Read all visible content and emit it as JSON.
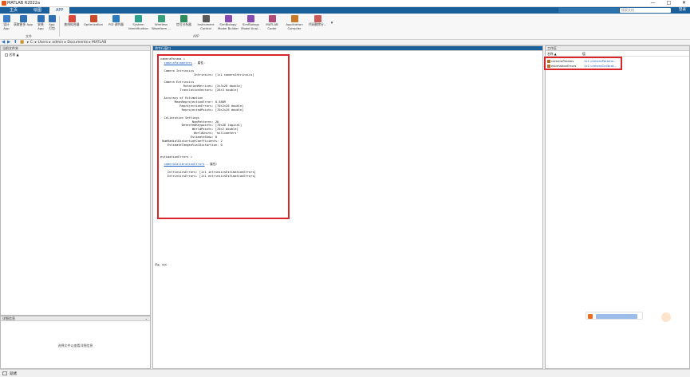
{
  "window": {
    "title": "MATLAB R2022a",
    "controls": [
      "—",
      "□",
      "✕"
    ]
  },
  "tabs": [
    {
      "label": "主页"
    },
    {
      "label": "绘图"
    },
    {
      "label": "APP"
    }
  ],
  "search": {
    "placeholder": "搜索文档"
  },
  "login_label": "登录",
  "toolstrip": {
    "file_group": [
      {
        "label": "设计\nApp"
      },
      {
        "label": "获取更多 App"
      },
      {
        "label": "安装\nApp"
      },
      {
        "label": "App\n打包"
      }
    ],
    "file_group_label": "文件",
    "apps": [
      {
        "label": "曲线拟合器",
        "color": "#d9473d"
      },
      {
        "label": "Optimization",
        "color": "#c94b2a"
      },
      {
        "label": "PID 调节器",
        "color": "#2b7bbd"
      },
      {
        "label": "System\nIdentification",
        "color": "#2f9f8e"
      },
      {
        "label": "Wireless\nWaveform ...",
        "color": "#3a9f7a"
      },
      {
        "label": "信号分析器",
        "color": "#2d8a5a"
      },
      {
        "label": "Instrument\nControl",
        "color": "#5a5a5a"
      },
      {
        "label": "SimBiology\nModel Builder",
        "color": "#8a4bb0"
      },
      {
        "label": "SimBiology\nModel Anal...",
        "color": "#8a4bb0"
      },
      {
        "label": "MATLAB\nCoder",
        "color": "#b04b7a"
      },
      {
        "label": "Application\nCompiler",
        "color": "#c87a2a"
      },
      {
        "label": "代码删除分...",
        "color": "#c85a5a"
      }
    ],
    "apps_group_label": "APP"
  },
  "address": {
    "path": "▸ C: ▸ Users ▸ admin ▸ Documents ▸ MATLAB"
  },
  "panels": {
    "current_folder": {
      "title": "当前文件夹",
      "column": "名称 ▲"
    },
    "details": {
      "title": "详细信息",
      "empty_text": "选择文件以查看详细信息"
    },
    "command_window": {
      "title": "命令行窗口"
    },
    "workspace": {
      "title": "工作区",
      "col_name": "名称 ▲",
      "col_value": "值"
    }
  },
  "command_output": {
    "line1": "cameraParams =",
    "class1": "cameraParameters",
    "props_suffix": " - 属性:",
    "body1": "  Camera Intrinsics\n                   Intrinsics: [1×1 cameraIntrinsics]\n\n  Camera Extrinsics\n             RotationMatrices: [3×3×26 double]\n           TranslationVectors: [26×3 double]\n\n  Accuracy of Estimation\n        MeanReprojectionError: 0.5889\n           ReprojectionErrors: [70×2×26 double]\n            ReprojectedPoints: [70×2×26 double]\n\n  Calibration Settings\n                  NumPatterns: 26\n            DetectedKeypoints: [70×26 logical]\n                  WorldPoints: [70×2 double]\n                   WorldUnits: 'millimeters'\n                 EstimateSkew: 0\n NumRadialDistortionCoefficients: 2\n    EstimateTangentialDistortion: 0",
    "line2": "estimationErrors =",
    "class2": "cameraCalibrationErrors",
    "body2": "    IntrinsicsErrors: [1×1 intrinsicsEstimationErrors]\n    ExtrinsicsErrors: [1×1 extrinsicsEstimationErrors]",
    "prompt": "fx >>"
  },
  "workspace": {
    "vars": [
      {
        "name": "cameraParams",
        "value": "1x1 cameraParame..."
      },
      {
        "name": "estimationErrors",
        "value": "1x1 cameraCalibrat..."
      }
    ]
  },
  "status": {
    "label": "就绪"
  },
  "colors": {
    "accent": "#1a5e9a",
    "highlight": "#d9262b"
  }
}
